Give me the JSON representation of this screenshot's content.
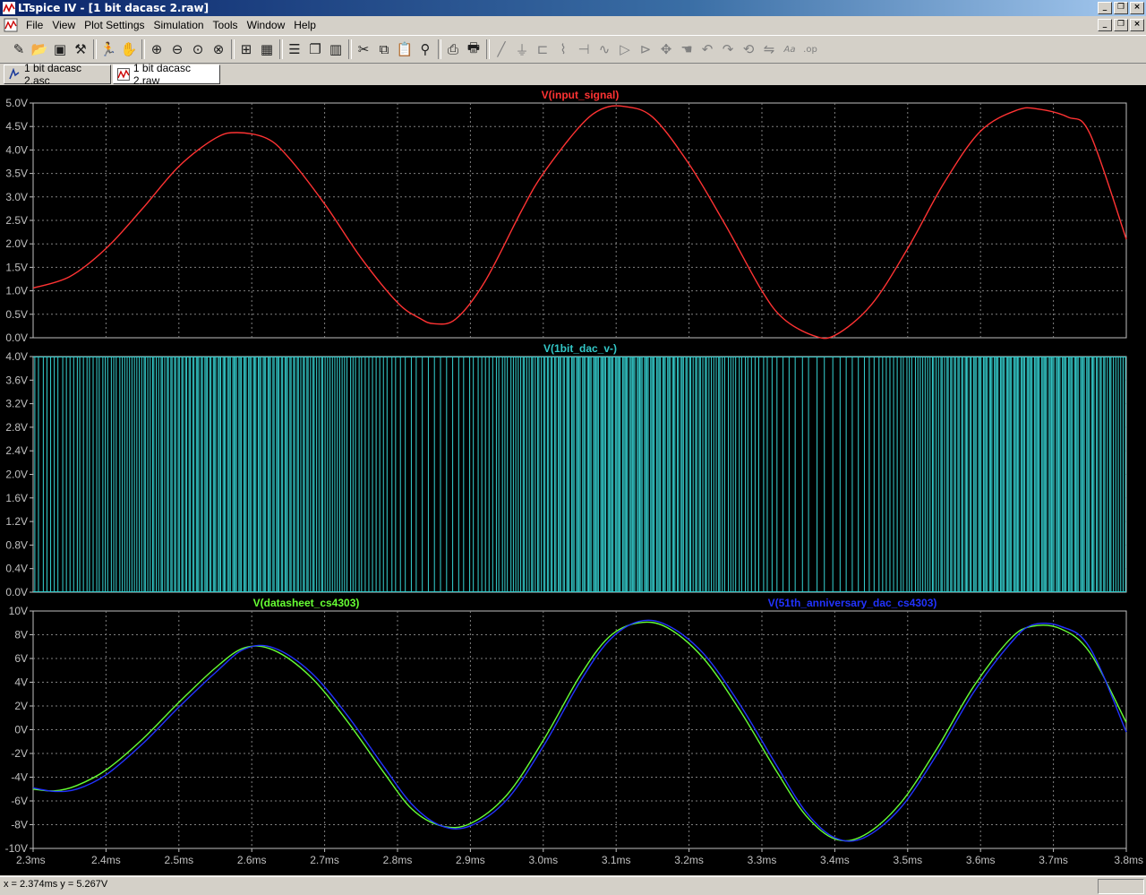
{
  "window": {
    "title": "LTspice IV - [1 bit dacasc 2.raw]"
  },
  "menu": {
    "items": [
      "File",
      "View",
      "Plot Settings",
      "Simulation",
      "Tools",
      "Window",
      "Help"
    ]
  },
  "toolbar": {
    "icons": [
      "new-schematic-icon",
      "open-icon",
      "save-icon",
      "control-panel-icon",
      "run-icon",
      "halt-icon",
      "zoom-in-icon",
      "zoom-out-icon",
      "zoom-fit-icon",
      "zoom-cancel-icon",
      "autorange-icon",
      "plot-settings-icon",
      "tile-horizontal-icon",
      "cascade-icon",
      "tile-vertical-icon",
      "cut-icon",
      "copy-icon",
      "paste-icon",
      "find-icon",
      "print-preview-icon",
      "print-icon",
      "draw-wire-icon",
      "ground-icon",
      "label-net-icon",
      "resistor-icon",
      "capacitor-icon",
      "inductor-icon",
      "diode-icon",
      "component-icon",
      "move-icon",
      "drag-icon",
      "undo-icon",
      "redo-icon",
      "rotate-icon",
      "mirror-icon",
      "text-icon",
      "spice-directive-icon"
    ]
  },
  "tabs": [
    {
      "label": "1 bit dacasc 2.asc",
      "icon": "schematic-icon",
      "active": false
    },
    {
      "label": "1 bit dacasc 2.raw",
      "icon": "waveform-icon",
      "active": true
    }
  ],
  "status": {
    "text": "x = 2.374ms    y = 5.267V"
  },
  "colors": {
    "background": "#000000",
    "grid": "#808080",
    "axis_text": "#c0c0c0",
    "frame": "#c0c0c0",
    "red": "#ff3333",
    "cyan": "#33c8c8",
    "green": "#66ff33",
    "blue": "#2233ff"
  },
  "chart_data": [
    {
      "type": "line",
      "series": [
        {
          "name": "V(input_signal)",
          "color": "#ff3333",
          "x": [
            2.3,
            2.35,
            2.4,
            2.45,
            2.5,
            2.55,
            2.58,
            2.62,
            2.65,
            2.7,
            2.75,
            2.8,
            2.83,
            2.85,
            2.88,
            2.92,
            2.97,
            3.0,
            3.05,
            3.08,
            3.11,
            3.15,
            3.2,
            3.25,
            3.3,
            3.33,
            3.37,
            3.4,
            3.45,
            3.5,
            3.55,
            3.6,
            3.65,
            3.68,
            3.72,
            3.75,
            3.8
          ],
          "y": [
            1.06,
            1.3,
            1.9,
            2.75,
            3.65,
            4.25,
            4.37,
            4.25,
            3.85,
            2.85,
            1.7,
            0.75,
            0.42,
            0.3,
            0.4,
            1.2,
            2.7,
            3.5,
            4.5,
            4.87,
            4.93,
            4.7,
            3.7,
            2.4,
            1.0,
            0.4,
            0.05,
            0.05,
            0.7,
            1.9,
            3.3,
            4.4,
            4.85,
            4.87,
            4.7,
            4.35,
            2.1
          ]
        }
      ],
      "xlim": [
        2.3,
        3.8
      ],
      "ylim": [
        0,
        5
      ],
      "y_ticks": [
        "5.0V",
        "4.5V",
        "4.0V",
        "3.5V",
        "3.0V",
        "2.5V",
        "2.0V",
        "1.5V",
        "1.0V",
        "0.5V",
        "0.0V"
      ],
      "grid": true
    },
    {
      "type": "line",
      "series": [
        {
          "name": "V(1bit_dac_v-)",
          "color": "#33c8c8",
          "levels": [
            0,
            4
          ],
          "density": "pulse train, dense high-frequency switching between 0V and 4V"
        }
      ],
      "xlim": [
        2.3,
        3.8
      ],
      "ylim": [
        0,
        4
      ],
      "y_ticks": [
        "4.0V",
        "3.6V",
        "3.2V",
        "2.8V",
        "2.4V",
        "2.0V",
        "1.6V",
        "1.2V",
        "0.8V",
        "0.4V",
        "0.0V"
      ],
      "grid": true
    },
    {
      "type": "line",
      "series": [
        {
          "name": "V(datasheet_cs4303)",
          "color": "#66ff33",
          "x": [
            2.3,
            2.33,
            2.36,
            2.4,
            2.45,
            2.5,
            2.55,
            2.59,
            2.63,
            2.68,
            2.73,
            2.78,
            2.82,
            2.86,
            2.9,
            2.95,
            3.0,
            3.05,
            3.09,
            3.13,
            3.17,
            3.22,
            3.27,
            3.32,
            3.36,
            3.4,
            3.44,
            3.49,
            3.54,
            3.59,
            3.64,
            3.67,
            3.71,
            3.75,
            3.8
          ],
          "y": [
            -5.0,
            -5.15,
            -4.7,
            -3.4,
            -0.8,
            2.3,
            5.2,
            6.9,
            6.7,
            4.5,
            0.8,
            -3.5,
            -6.7,
            -8.1,
            -7.9,
            -5.5,
            -0.9,
            4.5,
            7.8,
            9.0,
            8.6,
            6.0,
            1.6,
            -3.5,
            -7.2,
            -9.2,
            -8.9,
            -6.2,
            -1.6,
            3.6,
            7.6,
            8.7,
            8.5,
            6.5,
            0.6
          ]
        },
        {
          "name": "V(51th_anniversary_dac_cs4303)",
          "color": "#2233ff",
          "x": [
            2.3,
            2.33,
            2.36,
            2.4,
            2.45,
            2.5,
            2.55,
            2.59,
            2.63,
            2.68,
            2.73,
            2.78,
            2.82,
            2.86,
            2.9,
            2.95,
            3.0,
            3.05,
            3.09,
            3.13,
            3.17,
            3.22,
            3.27,
            3.32,
            3.36,
            3.4,
            3.44,
            3.49,
            3.54,
            3.59,
            3.64,
            3.67,
            3.71,
            3.75,
            3.8
          ],
          "y": [
            -4.9,
            -5.2,
            -5.0,
            -3.8,
            -1.2,
            1.9,
            4.8,
            6.8,
            6.9,
            4.9,
            1.3,
            -3.0,
            -6.3,
            -8.1,
            -8.1,
            -5.9,
            -1.4,
            4.0,
            7.5,
            9.1,
            8.8,
            6.4,
            2.1,
            -3.0,
            -6.9,
            -9.1,
            -9.1,
            -6.6,
            -2.1,
            3.1,
            7.2,
            8.8,
            8.7,
            6.9,
            -0.2
          ]
        }
      ],
      "xlim": [
        2.3,
        3.8
      ],
      "ylim": [
        -10,
        10
      ],
      "y_ticks": [
        "10V",
        "8V",
        "6V",
        "4V",
        "2V",
        "0V",
        "-2V",
        "-4V",
        "-6V",
        "-8V",
        "-10V"
      ],
      "x_ticks": [
        "2.3ms",
        "2.4ms",
        "2.5ms",
        "2.6ms",
        "2.7ms",
        "2.8ms",
        "2.9ms",
        "3.0ms",
        "3.1ms",
        "3.2ms",
        "3.3ms",
        "3.4ms",
        "3.5ms",
        "3.6ms",
        "3.7ms",
        "3.8ms"
      ],
      "grid": true
    }
  ]
}
